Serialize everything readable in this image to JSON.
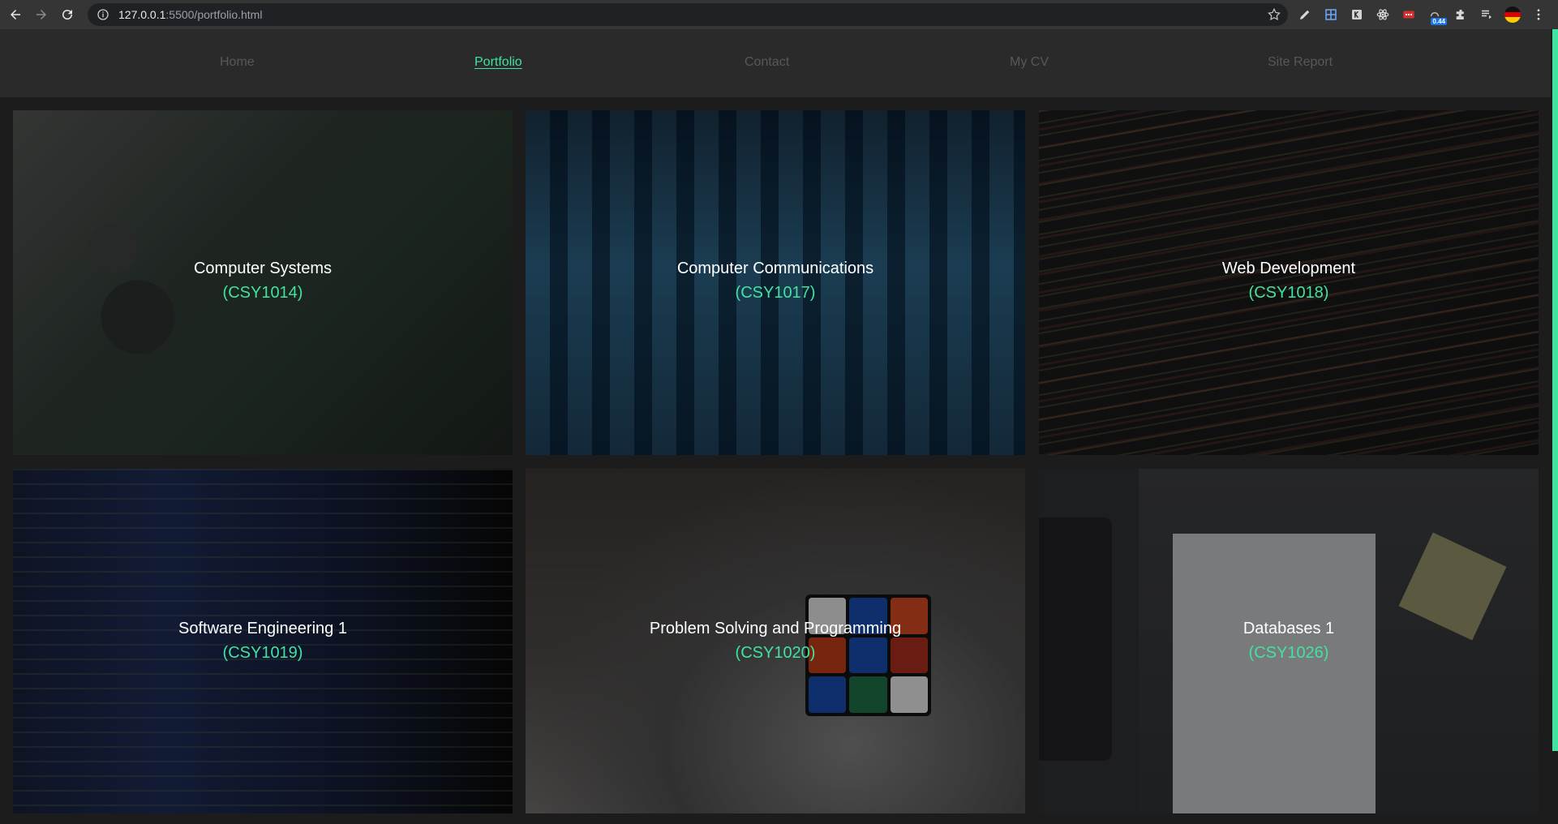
{
  "browser": {
    "url_host": "127.0.0.1",
    "url_rest": ":5500/portfolio.html",
    "extension_badge": "0.44"
  },
  "nav": {
    "items": [
      {
        "label": "Home"
      },
      {
        "label": "Portfolio"
      },
      {
        "label": "Contact"
      },
      {
        "label": "My CV"
      },
      {
        "label": "Site Report"
      }
    ],
    "active": "Portfolio"
  },
  "modules": [
    {
      "title": "Computer Systems",
      "code": "(CSY1014)"
    },
    {
      "title": "Computer Communications",
      "code": "(CSY1017)"
    },
    {
      "title": "Web Development",
      "code": "(CSY1018)"
    },
    {
      "title": "Software Engineering 1",
      "code": "(CSY1019)"
    },
    {
      "title": "Problem Solving and Programming",
      "code": "(CSY1020)"
    },
    {
      "title": "Databases 1",
      "code": "(CSY1026)"
    }
  ],
  "colors": {
    "accent": "#40e3a0",
    "nav_bg": "#2a2a2a",
    "page_bg": "#1c1c1c",
    "nav_inactive": "#585858"
  }
}
